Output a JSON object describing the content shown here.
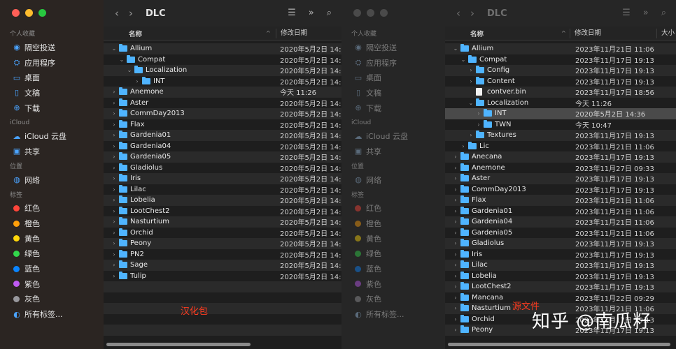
{
  "left": {
    "title": "DLC",
    "header": {
      "name": "名称",
      "date": "修改日期"
    },
    "sidebar": {
      "favorites_label": "个人收藏",
      "favorites": [
        {
          "icon": "airdrop-icon",
          "glyph": "◉",
          "label": "隔空投送"
        },
        {
          "icon": "applications-icon",
          "glyph": "⛭",
          "label": "应用程序"
        },
        {
          "icon": "desktop-icon",
          "glyph": "▭",
          "label": "桌面"
        },
        {
          "icon": "document-icon",
          "glyph": "▯",
          "label": "文稿"
        },
        {
          "icon": "download-icon",
          "glyph": "⊕",
          "label": "下载"
        }
      ],
      "icloud_label": "iCloud",
      "icloud": [
        {
          "icon": "cloud-icon",
          "glyph": "☁",
          "label": "iCloud 云盘"
        },
        {
          "icon": "shared-folder-icon",
          "glyph": "▣",
          "label": "共享"
        }
      ],
      "locations_label": "位置",
      "locations": [
        {
          "icon": "network-icon",
          "glyph": "◍",
          "label": "网络"
        }
      ],
      "tags_label": "标签",
      "tags": [
        {
          "label": "红色",
          "color": "#ff453a"
        },
        {
          "label": "橙色",
          "color": "#ff9f0a"
        },
        {
          "label": "黄色",
          "color": "#ffd60a"
        },
        {
          "label": "绿色",
          "color": "#32d74b"
        },
        {
          "label": "蓝色",
          "color": "#0a84ff"
        },
        {
          "label": "紫色",
          "color": "#bf5af2"
        },
        {
          "label": "灰色",
          "color": "#98989d"
        }
      ],
      "all_tags": {
        "icon": "all-tags-icon",
        "glyph": "◐",
        "label": "所有标签..."
      }
    },
    "rows": [
      {
        "level": 0,
        "expanded": true,
        "type": "folder",
        "name": "Allium",
        "date": "2020年5月2日 14:"
      },
      {
        "level": 1,
        "expanded": true,
        "type": "folder",
        "name": "Compat",
        "date": "2020年5月2日 14:"
      },
      {
        "level": 2,
        "expanded": true,
        "type": "folder",
        "name": "Localization",
        "date": "2020年5月2日 14:"
      },
      {
        "level": 3,
        "expanded": false,
        "type": "folder",
        "name": "INT",
        "date": "2020年5月2日 14:"
      },
      {
        "level": 0,
        "expanded": false,
        "type": "folder",
        "name": "Anemone",
        "date": "今天 11:26"
      },
      {
        "level": 0,
        "expanded": false,
        "type": "folder",
        "name": "Aster",
        "date": "2020年5月2日 14:"
      },
      {
        "level": 0,
        "expanded": false,
        "type": "folder",
        "name": "CommDay2013",
        "date": "2020年5月2日 14:"
      },
      {
        "level": 0,
        "expanded": false,
        "type": "folder",
        "name": "Flax",
        "date": "2020年5月2日 14:"
      },
      {
        "level": 0,
        "expanded": false,
        "type": "folder",
        "name": "Gardenia01",
        "date": "2020年5月2日 14:"
      },
      {
        "level": 0,
        "expanded": false,
        "type": "folder",
        "name": "Gardenia04",
        "date": "2020年5月2日 14:"
      },
      {
        "level": 0,
        "expanded": false,
        "type": "folder",
        "name": "Gardenia05",
        "date": "2020年5月2日 14:"
      },
      {
        "level": 0,
        "expanded": false,
        "type": "folder",
        "name": "Gladiolus",
        "date": "2020年5月2日 14:"
      },
      {
        "level": 0,
        "expanded": false,
        "type": "folder",
        "name": "Iris",
        "date": "2020年5月2日 14:"
      },
      {
        "level": 0,
        "expanded": false,
        "type": "folder",
        "name": "Lilac",
        "date": "2020年5月2日 14:"
      },
      {
        "level": 0,
        "expanded": false,
        "type": "folder",
        "name": "Lobelia",
        "date": "2020年5月2日 14:"
      },
      {
        "level": 0,
        "expanded": false,
        "type": "folder",
        "name": "LootChest2",
        "date": "2020年5月2日 14:"
      },
      {
        "level": 0,
        "expanded": false,
        "type": "folder",
        "name": "Nasturtium",
        "date": "2020年5月2日 14:"
      },
      {
        "level": 0,
        "expanded": false,
        "type": "folder",
        "name": "Orchid",
        "date": "2020年5月2日 14:"
      },
      {
        "level": 0,
        "expanded": false,
        "type": "folder",
        "name": "Peony",
        "date": "2020年5月2日 14:"
      },
      {
        "level": 0,
        "expanded": false,
        "type": "folder",
        "name": "PN2",
        "date": "2020年5月2日 14:"
      },
      {
        "level": 0,
        "expanded": false,
        "type": "folder",
        "name": "Sage",
        "date": "2020年5月2日 14:"
      },
      {
        "level": 0,
        "expanded": false,
        "type": "folder",
        "name": "Tulip",
        "date": "2020年5月2日 14:"
      }
    ],
    "annotation": "汉化包"
  },
  "right": {
    "title": "DLC",
    "header": {
      "name": "名称",
      "date": "修改日期",
      "size": "大小"
    },
    "rows": [
      {
        "level": 0,
        "expanded": true,
        "type": "folder",
        "name": "Allium",
        "date": "2023年11月21日 11:06"
      },
      {
        "level": 1,
        "expanded": true,
        "type": "folder",
        "name": "Compat",
        "date": "2023年11月17日 19:13"
      },
      {
        "level": 2,
        "expanded": false,
        "type": "folder",
        "name": "Config",
        "date": "2023年11月17日 19:13"
      },
      {
        "level": 2,
        "expanded": false,
        "type": "folder",
        "name": "Content",
        "date": "2023年11月17日 19:13"
      },
      {
        "level": 2,
        "expanded": false,
        "type": "file",
        "name": "contver.bin",
        "date": "2023年11月17日 18:56"
      },
      {
        "level": 2,
        "expanded": true,
        "type": "folder",
        "name": "Localization",
        "date": "今天 11:26"
      },
      {
        "level": 3,
        "expanded": false,
        "type": "folder",
        "name": "INT",
        "date": "2020年5月2日 14:36",
        "selected": true
      },
      {
        "level": 3,
        "expanded": false,
        "type": "folder",
        "name": "TWN",
        "date": "今天 10:47"
      },
      {
        "level": 2,
        "expanded": false,
        "type": "folder",
        "name": "Textures",
        "date": "2023年11月17日 19:13"
      },
      {
        "level": 1,
        "expanded": false,
        "type": "folder",
        "name": "Lic",
        "date": "2023年11月21日 11:06"
      },
      {
        "level": 0,
        "expanded": false,
        "type": "folder",
        "name": "Anecana",
        "date": "2023年11月17日 19:13"
      },
      {
        "level": 0,
        "expanded": false,
        "type": "folder",
        "name": "Anemone",
        "date": "2023年11月27日 09:33"
      },
      {
        "level": 0,
        "expanded": false,
        "type": "folder",
        "name": "Aster",
        "date": "2023年11月17日 19:13"
      },
      {
        "level": 0,
        "expanded": false,
        "type": "folder",
        "name": "CommDay2013",
        "date": "2023年11月17日 19:13"
      },
      {
        "level": 0,
        "expanded": false,
        "type": "folder",
        "name": "Flax",
        "date": "2023年11月21日 11:06"
      },
      {
        "level": 0,
        "expanded": false,
        "type": "folder",
        "name": "Gardenia01",
        "date": "2023年11月21日 11:06"
      },
      {
        "level": 0,
        "expanded": false,
        "type": "folder",
        "name": "Gardenia04",
        "date": "2023年11月21日 11:06"
      },
      {
        "level": 0,
        "expanded": false,
        "type": "folder",
        "name": "Gardenia05",
        "date": "2023年11月21日 11:06"
      },
      {
        "level": 0,
        "expanded": false,
        "type": "folder",
        "name": "Gladiolus",
        "date": "2023年11月17日 19:13"
      },
      {
        "level": 0,
        "expanded": false,
        "type": "folder",
        "name": "Iris",
        "date": "2023年11月17日 19:13"
      },
      {
        "level": 0,
        "expanded": false,
        "type": "folder",
        "name": "Lilac",
        "date": "2023年11月17日 19:13"
      },
      {
        "level": 0,
        "expanded": false,
        "type": "folder",
        "name": "Lobelia",
        "date": "2023年11月17日 19:13"
      },
      {
        "level": 0,
        "expanded": false,
        "type": "folder",
        "name": "LootChest2",
        "date": "2023年11月17日 19:13"
      },
      {
        "level": 0,
        "expanded": false,
        "type": "folder",
        "name": "Mancana",
        "date": "2023年11月22日 09:29"
      },
      {
        "level": 0,
        "expanded": false,
        "type": "folder",
        "name": "Nasturtium",
        "date": "2023年11月21日 11:06"
      },
      {
        "level": 0,
        "expanded": false,
        "type": "folder",
        "name": "Orchid",
        "date": "2023年11月17日 19:13"
      },
      {
        "level": 0,
        "expanded": false,
        "type": "folder",
        "name": "Peony",
        "date": "2023年11月17日 19:13"
      }
    ],
    "annotation": "源文件"
  },
  "watermark": "知乎 @南瓜籽",
  "traffic_lights": {
    "close": "#ff5f57",
    "minimize": "#febc2e",
    "zoom": "#28c840"
  },
  "toolbar_icons": {
    "back": "‹",
    "forward": "›",
    "list": "☰",
    "more": "»",
    "search": "⌕"
  }
}
